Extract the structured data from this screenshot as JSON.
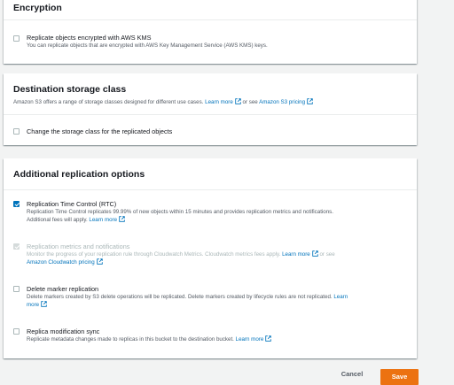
{
  "encryption": {
    "title": "Encryption",
    "option": {
      "label": "Replicate objects encrypted with AWS KMS",
      "description": "You can replicate objects that are encrypted with AWS Key Management Service (AWS KMS) keys.",
      "checked": false
    }
  },
  "storage_class": {
    "title": "Destination storage class",
    "description_prefix": "Amazon S3 offers a range of storage classes designed for different use cases.",
    "learn_more": "Learn more",
    "or_see": "or see",
    "pricing_link": "Amazon S3 pricing",
    "option": {
      "label": "Change the storage class for the replicated objects",
      "checked": false
    }
  },
  "additional": {
    "title": "Additional replication options",
    "options": [
      {
        "label": "Replication Time Control (RTC)",
        "description": "Replication Time Control replicates 99.99% of new objects within 15 minutes and provides replication metrics and notifications.",
        "description2": "Additional fees will apply.",
        "link": "Learn more",
        "checked": true,
        "disabled": false
      },
      {
        "label": "Replication metrics and notifications",
        "description": "Monitor the progress of your replication rule through Cloudwatch Metrics. Cloudwatch metrics fees apply.",
        "link": "Learn more",
        "or_see": "or see",
        "link2": "Amazon Cloudwatch pricing",
        "checked": true,
        "disabled": true
      },
      {
        "label": "Delete marker replication",
        "description": "Delete markers created by S3 delete operations will be replicated. Delete markers created by lifecycle rules are not replicated.",
        "link_part1": "Learn",
        "link_part2": "more",
        "checked": false,
        "disabled": false
      },
      {
        "label": "Replica modification sync",
        "description": "Replicate metadata changes made to replicas in this bucket to the destination bucket.",
        "link": "Learn more",
        "checked": false,
        "disabled": false
      }
    ]
  },
  "footer": {
    "cancel_label": "Cancel",
    "save_label": "Save"
  },
  "colors": {
    "link": "#0073bb",
    "primary_button": "#ec7211",
    "checkbox_checked": "#0073bb"
  }
}
